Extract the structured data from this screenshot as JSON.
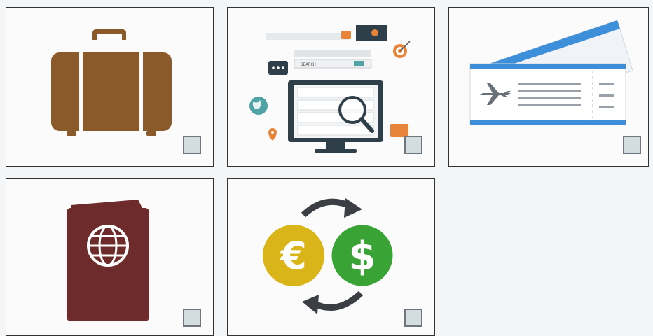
{
  "cards": [
    {
      "icon": "suitcase-icon",
      "checked": false
    },
    {
      "icon": "online-search-computer-icon",
      "checked": false
    },
    {
      "icon": "plane-ticket-icon",
      "checked": false
    },
    {
      "icon": "passport-icon",
      "checked": false
    },
    {
      "icon": "currency-exchange-icon",
      "checked": false
    }
  ],
  "colors": {
    "suitcase": "#8b5a2b",
    "passport": "#6e2b2b",
    "euro_coin": "#d9b51a",
    "dollar_coin": "#3aa335",
    "ticket_stripe": "#3d8fd9",
    "monitor": "#2f3f49",
    "checkbox_fill": "#d3dde0"
  }
}
